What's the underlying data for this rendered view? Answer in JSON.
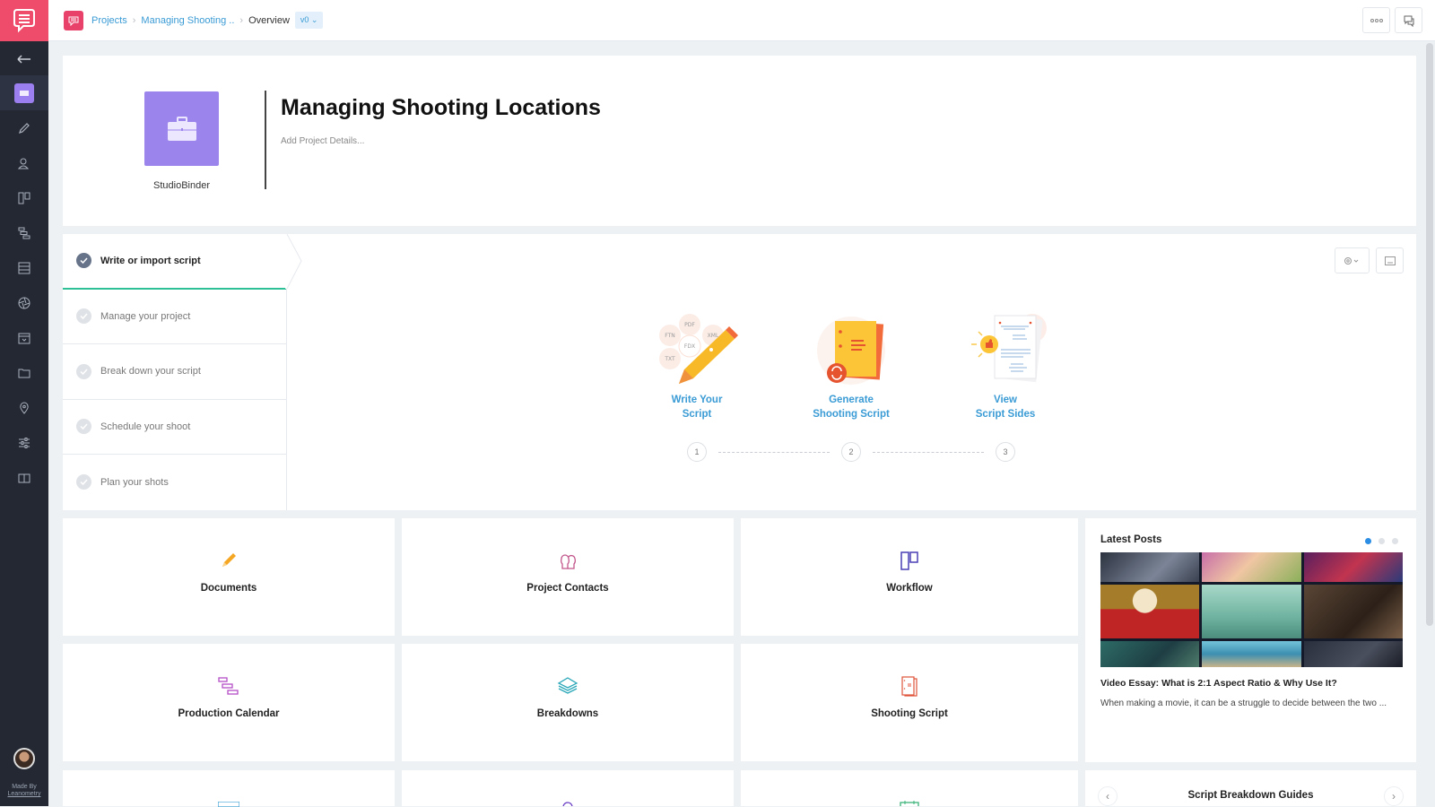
{
  "sidebar": {
    "logo_icon": "chat-bubble-lines-icon",
    "items": [
      {
        "icon": "arrow-left-icon",
        "name": "back"
      },
      {
        "icon": "overview-icon",
        "name": "overview",
        "active": true
      },
      {
        "icon": "pencil-icon",
        "name": "documents"
      },
      {
        "icon": "contacts-icon",
        "name": "contacts"
      },
      {
        "icon": "workflow-icon",
        "name": "workflow"
      },
      {
        "icon": "calendar-strips-icon",
        "name": "production-calendar"
      },
      {
        "icon": "breakdowns-icon",
        "name": "breakdowns"
      },
      {
        "icon": "aperture-icon",
        "name": "shot-list"
      },
      {
        "icon": "calendar-icon",
        "name": "calendar"
      },
      {
        "icon": "folder-icon",
        "name": "files"
      },
      {
        "icon": "location-pin-icon",
        "name": "locations"
      },
      {
        "icon": "sliders-icon",
        "name": "settings"
      },
      {
        "icon": "book-icon",
        "name": "script-sides"
      }
    ],
    "made_by": "Made By",
    "made_by_brand": "Leanometry"
  },
  "topbar": {
    "breadcrumb": {
      "projects": "Projects",
      "project": "Managing Shooting ..",
      "current": "Overview"
    },
    "version": "v0 ⌄",
    "more_icon": "ellipsis-icon",
    "comments_icon": "chat-icon"
  },
  "header": {
    "org": "StudioBinder",
    "title": "Managing Shooting Locations",
    "details_placeholder": "Add Project Details..."
  },
  "steps": [
    {
      "label": "Write or import script",
      "active": true
    },
    {
      "label": "Manage your project",
      "active": false
    },
    {
      "label": "Break down your script",
      "active": false
    },
    {
      "label": "Schedule your shoot",
      "active": false
    },
    {
      "label": "Plan your shots",
      "active": false
    }
  ],
  "features": [
    {
      "line1": "Write Your",
      "line2": "Script",
      "number": "1",
      "formats": [
        "PDF",
        "FTN",
        "FDX",
        "XML",
        "TXT"
      ]
    },
    {
      "line1": "Generate",
      "line2": "Shooting Script",
      "number": "2"
    },
    {
      "line1": "View",
      "line2": "Script Sides",
      "number": "3"
    }
  ],
  "tiles": [
    {
      "label": "Documents",
      "icon": "pencil-icon",
      "color": "#f5a623"
    },
    {
      "label": "Project Contacts",
      "icon": "contacts-icon",
      "color": "#c2548a"
    },
    {
      "label": "Workflow",
      "icon": "workflow-icon",
      "color": "#4a3fb5"
    },
    {
      "label": "Production Calendar",
      "icon": "calendar-strips-icon",
      "color": "#b44fc6"
    },
    {
      "label": "Breakdowns",
      "icon": "layers-icon",
      "color": "#2aa7b8"
    },
    {
      "label": "Shooting Script",
      "icon": "script-icon",
      "color": "#e0533a"
    }
  ],
  "posts": {
    "title": "Latest Posts",
    "slides": 3,
    "active_slide": 1,
    "post_title": "Video Essay: What is 2:1 Aspect Ratio & Why Use It?",
    "excerpt": "When making a movie, it can be a struggle to decide between the two ..."
  },
  "guides": {
    "title": "Script Breakdown Guides",
    "prev": "‹",
    "next": "›"
  },
  "colors": {
    "brand": "#ef4b6b",
    "accent": "#3a9bd5",
    "project_thumb": "#9b85ed",
    "step_active": "#2dbf96"
  }
}
